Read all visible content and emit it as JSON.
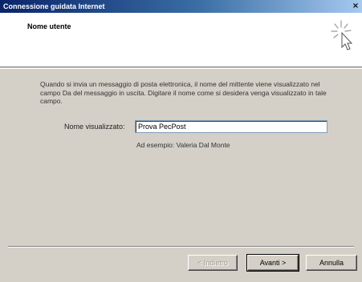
{
  "window": {
    "title": "Connessione guidata Internet",
    "close_glyph": "×"
  },
  "header": {
    "title": "Nome utente",
    "icon": "wizard-sparkle-cursor-icon"
  },
  "body": {
    "description": "Quando si invia un messaggio di posta elettronica, il nome del mittente viene visualizzato nel campo Da del messaggio in uscita. Digitare il nome come si desidera venga visualizzato in tale campo.",
    "name_label": "Nome visualizzato:",
    "name_value": "Prova PecPost",
    "example": "Ad esempio: Valeria Dal Monte"
  },
  "buttons": {
    "back": "< Indietro",
    "next": "Avanti >",
    "cancel": "Annulla"
  },
  "colors": {
    "titlebar_start": "#0a246a",
    "titlebar_end": "#a6caf0",
    "dialog_bg": "#d4d0c8"
  }
}
